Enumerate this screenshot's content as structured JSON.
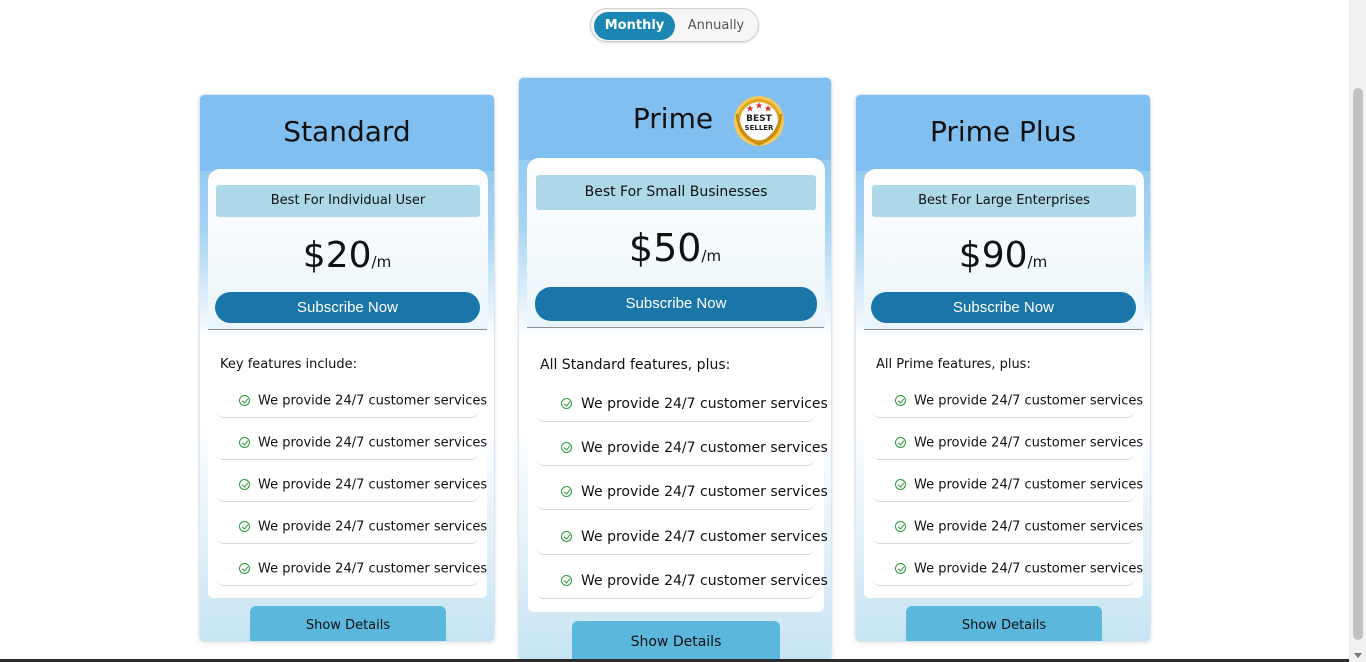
{
  "billing_toggle": {
    "monthly_label": "Monthly",
    "annually_label": "Annually",
    "selected": "Monthly"
  },
  "plans": [
    {
      "title": "Standard",
      "tag": "Best For Individual User",
      "price": "$20",
      "period": "/m",
      "subscribe_label": "Subscribe Now",
      "features_title": "Key features include:",
      "features": [
        "We provide 24/7 customer services",
        "We provide 24/7 customer services",
        "We provide 24/7 customer services",
        "We provide 24/7 customer services",
        "We provide 24/7 customer services"
      ],
      "details_label": "Show Details"
    },
    {
      "title": "Prime",
      "badge_text": [
        "BEST",
        "SELLER"
      ],
      "tag": "Best For Small Businesses",
      "price": "$50",
      "period": "/m",
      "subscribe_label": "Subscribe Now",
      "features_title": "All Standard features, plus:",
      "features": [
        "We provide 24/7 customer services",
        "We provide 24/7 customer services",
        "We provide 24/7 customer services",
        "We provide 24/7 customer services",
        "We provide 24/7 customer services"
      ],
      "details_label": "Show Details"
    },
    {
      "title": "Prime Plus",
      "tag": "Best For Large Enterprises",
      "price": "$90",
      "period": "/m",
      "subscribe_label": "Subscribe Now",
      "features_title": "All Prime features, plus:",
      "features": [
        "We provide 24/7 customer services",
        "We provide 24/7 customer services",
        "We provide 24/7 customer services",
        "We provide 24/7 customer services",
        "We provide 24/7 customer services"
      ],
      "details_label": "Show Details"
    }
  ],
  "colors": {
    "accent": "#1c86b2",
    "subscribe": "#1a76a9",
    "card_header": "#80bff0",
    "tag_bg": "#add8e8",
    "details_bg": "#5bb8dc",
    "check": "#2a9a3c",
    "badge_gold": "#d9a21b",
    "badge_stars": "#d8342c"
  }
}
